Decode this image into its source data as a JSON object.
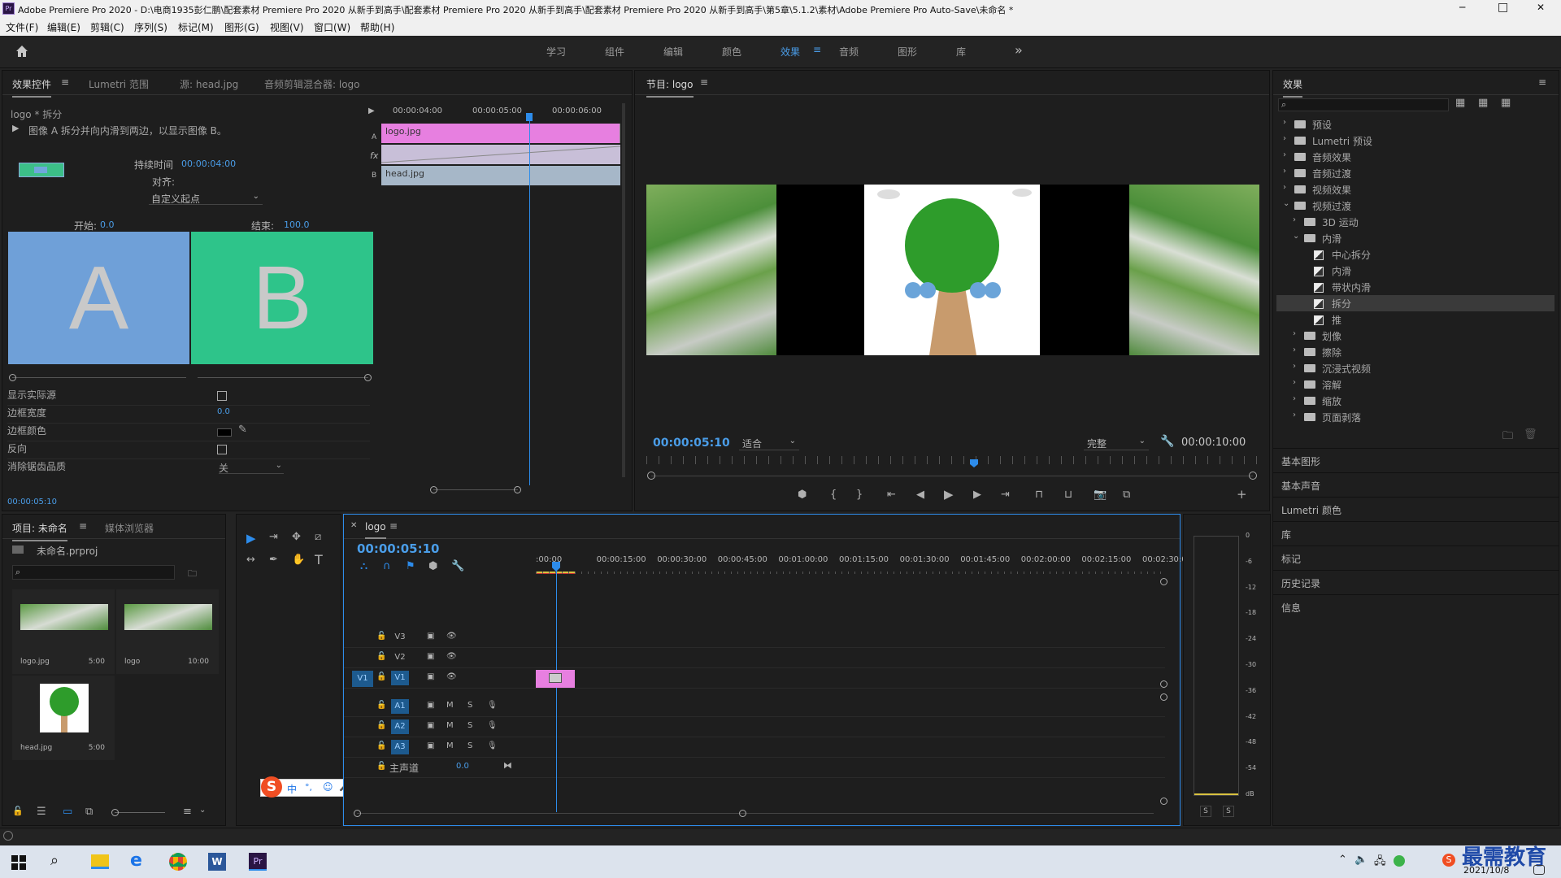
{
  "window": {
    "title": "Adobe Premiere Pro 2020 - D:\\电商1935彭仁鹏\\配套素材 Premiere Pro 2020 从新手到高手\\配套素材 Premiere Pro 2020 从新手到高手\\配套素材 Premiere Pro 2020 从新手到高手\\第5章\\5.1.2\\素材\\Adobe Premiere Pro Auto-Save\\未命名 *",
    "app_badge": "Pr",
    "min": "─",
    "max": "□",
    "close": "✕"
  },
  "menu": [
    "文件(F)",
    "编辑(E)",
    "剪辑(C)",
    "序列(S)",
    "标记(M)",
    "图形(G)",
    "视图(V)",
    "窗口(W)",
    "帮助(H)"
  ],
  "workspaces": [
    "学习",
    "组件",
    "编辑",
    "颜色",
    "效果",
    "音频",
    "图形",
    "库"
  ],
  "workspace_active": "效果",
  "workspace_more": "»",
  "effect_controls": {
    "tabs": [
      "效果控件",
      "Lumetri 范围",
      "源: head.jpg",
      "音频剪辑混合器: logo"
    ],
    "clip": "logo * 拆分",
    "description": "图像 A 拆分并向内滑到两边，以显示图像 B。",
    "duration_label": "持续时间",
    "duration": "00:00:04:00",
    "align_label": "对齐:",
    "align_value": "自定义起点",
    "start_label": "开始:",
    "start_value": "0.0",
    "end_label": "结束:",
    "end_value": "100.0",
    "letter_a": "A",
    "letter_b": "B",
    "params": [
      {
        "label": "显示实际源"
      },
      {
        "label": "边框宽度",
        "value": "0.0"
      },
      {
        "label": "边框颜色"
      },
      {
        "label": "反向"
      },
      {
        "label": "消除锯齿品质",
        "value": "关"
      }
    ],
    "timecode": "00:00:05:10",
    "mini_ruler": [
      "00:00:04:00",
      "00:00:05:00",
      "00:00:06:00"
    ],
    "clip_a": "logo.jpg",
    "clip_b": "head.jpg",
    "side_a": "A",
    "side_b": "B",
    "fx": "fx"
  },
  "program": {
    "title": "节目: logo",
    "timecode": "00:00:05:10",
    "fit": "适合",
    "quality": "完整",
    "duration": "00:00:10:00"
  },
  "effects": {
    "title": "效果",
    "tree": [
      {
        "label": "预设",
        "depth": 0,
        "type": "folder",
        "open": false
      },
      {
        "label": "Lumetri 预设",
        "depth": 0,
        "type": "folder",
        "open": false
      },
      {
        "label": "音频效果",
        "depth": 0,
        "type": "folder",
        "open": false
      },
      {
        "label": "音频过渡",
        "depth": 0,
        "type": "folder",
        "open": false
      },
      {
        "label": "视频效果",
        "depth": 0,
        "type": "folder",
        "open": false
      },
      {
        "label": "视频过渡",
        "depth": 0,
        "type": "folder",
        "open": true
      },
      {
        "label": "3D 运动",
        "depth": 1,
        "type": "folder",
        "open": false
      },
      {
        "label": "内滑",
        "depth": 1,
        "type": "folder",
        "open": true
      },
      {
        "label": "中心拆分",
        "depth": 2,
        "type": "fx"
      },
      {
        "label": "内滑",
        "depth": 2,
        "type": "fx"
      },
      {
        "label": "带状内滑",
        "depth": 2,
        "type": "fx"
      },
      {
        "label": "拆分",
        "depth": 2,
        "type": "fx",
        "selected": true
      },
      {
        "label": "推",
        "depth": 2,
        "type": "fx"
      },
      {
        "label": "划像",
        "depth": 1,
        "type": "folder",
        "open": false
      },
      {
        "label": "擦除",
        "depth": 1,
        "type": "folder",
        "open": false
      },
      {
        "label": "沉浸式视频",
        "depth": 1,
        "type": "folder",
        "open": false
      },
      {
        "label": "溶解",
        "depth": 1,
        "type": "folder",
        "open": false
      },
      {
        "label": "缩放",
        "depth": 1,
        "type": "folder",
        "open": false
      },
      {
        "label": "页面剥落",
        "depth": 1,
        "type": "folder",
        "open": false
      }
    ],
    "sections": [
      "基本图形",
      "基本声音",
      "Lumetri 颜色",
      "库",
      "标记",
      "历史记录",
      "信息"
    ]
  },
  "project": {
    "tabs": [
      "项目: 未命名",
      "媒体浏览器"
    ],
    "file": "未命名.prproj",
    "items": [
      {
        "name": "logo.jpg",
        "dur": "5:00"
      },
      {
        "name": "logo",
        "dur": "10:00"
      },
      {
        "name": "head.jpg",
        "dur": "5:00"
      }
    ]
  },
  "tools": [
    "▶",
    "⇥",
    "✥",
    "⧄",
    "↔",
    "✒",
    "✋",
    "T"
  ],
  "timeline": {
    "tab": "logo",
    "timecode": "00:00:05:10",
    "ruler": [
      ":00:00",
      "00:00:15:00",
      "00:00:30:00",
      "00:00:45:00",
      "00:01:00:00",
      "00:01:15:00",
      "00:01:30:00",
      "00:01:45:00",
      "00:02:00:00",
      "00:02:15:00",
      "00:02:30:0"
    ],
    "video_tracks": [
      "V3",
      "V2",
      "V1"
    ],
    "audio_tracks": [
      "A1",
      "A2",
      "A3"
    ],
    "source_patch": "V1",
    "master": "主声道",
    "master_value": "0.0",
    "mute": "M",
    "solo": "S"
  },
  "meter": {
    "scale": [
      "0",
      "-6",
      "-12",
      "-18",
      "-24",
      "-30",
      "-36",
      "-42",
      "-48",
      "-54",
      "dB"
    ],
    "solo": [
      "S",
      "S"
    ]
  },
  "ime": {
    "items": [
      "中",
      "°,",
      "☺",
      "🎤",
      "⌨",
      "👕",
      "⊞"
    ]
  },
  "taskbar": {
    "date": "2021/10/8",
    "watermark": "最需教育"
  },
  "colors": {
    "accent": "#2d8ceb",
    "clip_pink": "#e77fe0",
    "panel": "#1e1e1e"
  }
}
